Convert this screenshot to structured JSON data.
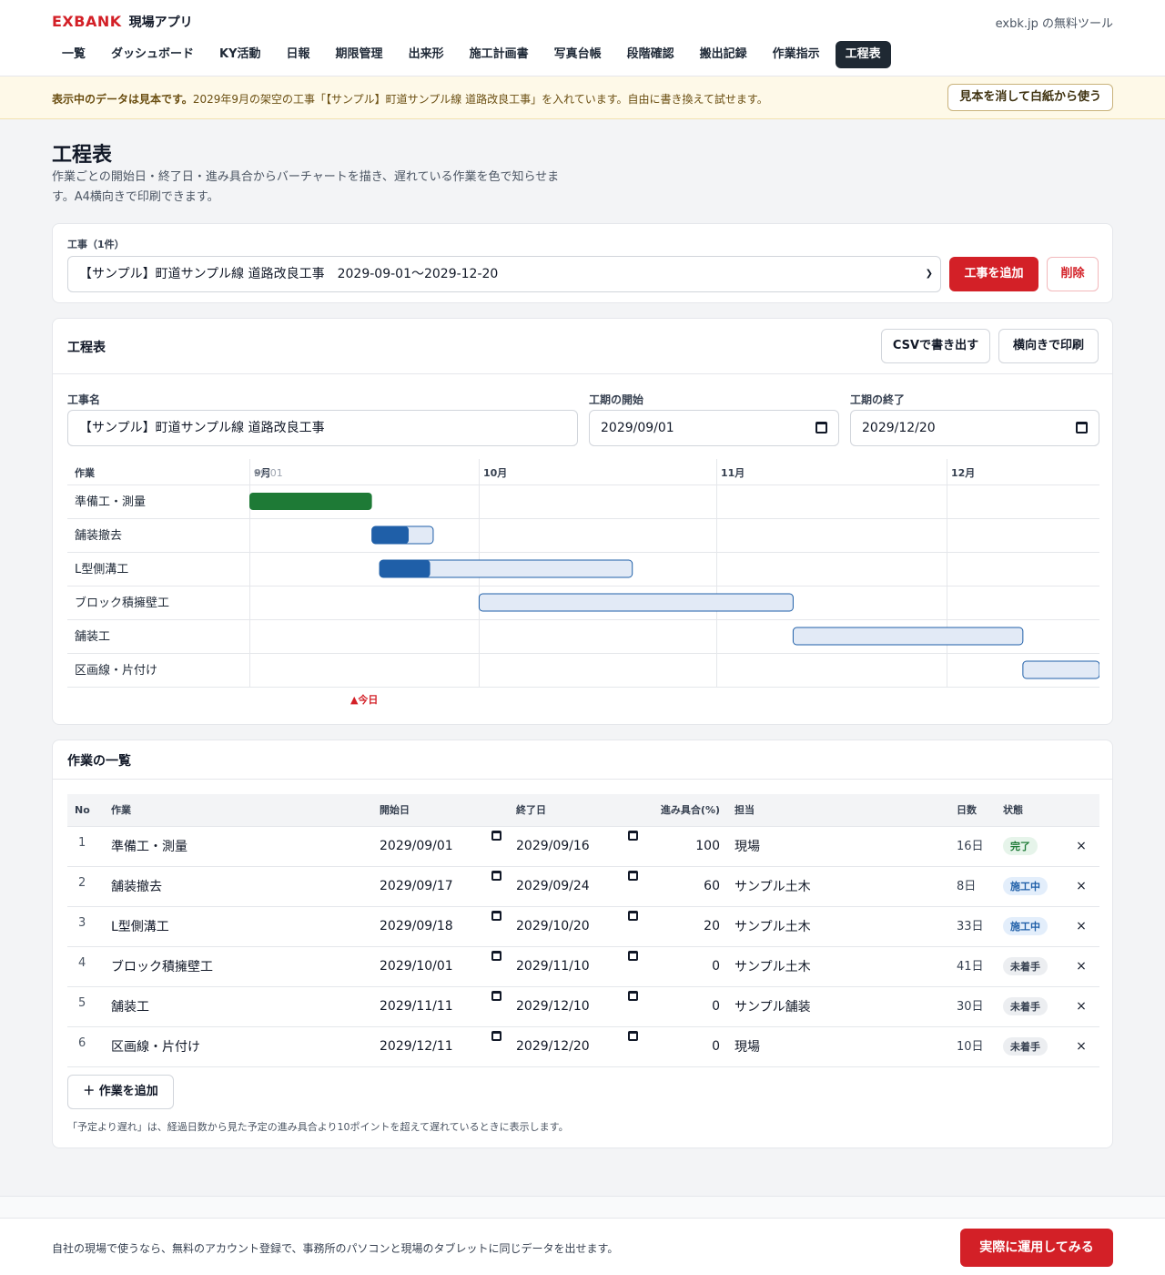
{
  "header": {
    "brand": "EXBANK",
    "app_name": "現場アプリ",
    "ext_link": "exbk.jp の無料ツール",
    "nav": [
      "一覧",
      "ダッシュボード",
      "KY活動",
      "日報",
      "期限管理",
      "出来形",
      "施工計画書",
      "写真台帳",
      "段階確認",
      "搬出記録",
      "作業指示",
      "工程表"
    ],
    "active_nav": "工程表"
  },
  "banner": {
    "bold": "表示中のデータは見本です。",
    "text": "2029年9月の架空の工事「【サンプル】町道サンプル線 道路改良工事」を入れています。自由に書き換えて試せます。",
    "button": "見本を消して白紙から使う"
  },
  "page": {
    "title": "工程表",
    "description": "作業ごとの開始日・終了日・進み具合からバーチャートを描き、遅れている作業を色で知らせます。A4横向きで印刷できます。"
  },
  "project_select": {
    "label": "工事（1件）",
    "selected": "【サンプル】町道サンプル線 道路改良工事　2029-09-01〜2029-12-20",
    "add_button": "工事を追加",
    "delete_button": "削除"
  },
  "schedule": {
    "title": "工程表",
    "csv_button": "CSVで書き出す",
    "print_button": "横向きで印刷",
    "name_label": "工事名",
    "name_value": "【サンプル】町道サンプル線 道路改良工事",
    "start_label": "工期の開始",
    "start_value": "2029/09/01",
    "end_label": "工期の終了",
    "end_value": "2029/12/20",
    "task_header": "作業",
    "today_label": "▲今日"
  },
  "chart_data": {
    "type": "gantt",
    "range": [
      "2029-09-01",
      "2029-12-20"
    ],
    "today": "2029-09-16",
    "months": [
      {
        "label": "9月",
        "date": "2029-09-01"
      },
      {
        "label": "10月",
        "date": "2029-10-01"
      },
      {
        "label": "11月",
        "date": "2029-11-01"
      },
      {
        "label": "12月",
        "date": "2029-12-01"
      }
    ],
    "start_tick_label": "09/01",
    "bars": [
      {
        "task": "準備工・測量",
        "start": "2029-09-01",
        "end": "2029-09-16",
        "progress": 100
      },
      {
        "task": "舗装撤去",
        "start": "2029-09-17",
        "end": "2029-09-24",
        "progress": 60
      },
      {
        "task": "L型側溝工",
        "start": "2029-09-18",
        "end": "2029-10-20",
        "progress": 20
      },
      {
        "task": "ブロック積擁壁工",
        "start": "2029-10-01",
        "end": "2029-11-10",
        "progress": 0
      },
      {
        "task": "舗装工",
        "start": "2029-11-11",
        "end": "2029-12-10",
        "progress": 0
      },
      {
        "task": "区画線・片付け",
        "start": "2029-12-11",
        "end": "2029-12-20",
        "progress": 0
      }
    ],
    "colors": {
      "done": "#1e7a36",
      "progress": "#1f5fa8",
      "remaining": "#e2eaf6",
      "today": "#d32027"
    }
  },
  "task_list": {
    "title": "作業の一覧",
    "columns": [
      "No",
      "作業",
      "開始日",
      "終了日",
      "進み具合(%)",
      "担当",
      "日数",
      "状態"
    ],
    "rows": [
      {
        "no": "1",
        "name": "準備工・測量",
        "start": "2029/09/01",
        "end": "2029/09/16",
        "progress": "100",
        "owner": "現場",
        "days": "16日",
        "status": "完了",
        "status_type": "done"
      },
      {
        "no": "2",
        "name": "舗装撤去",
        "start": "2029/09/17",
        "end": "2029/09/24",
        "progress": "60",
        "owner": "サンプル土木",
        "days": "8日",
        "status": "施工中",
        "status_type": "prog"
      },
      {
        "no": "3",
        "name": "L型側溝工",
        "start": "2029/09/18",
        "end": "2029/10/20",
        "progress": "20",
        "owner": "サンプル土木",
        "days": "33日",
        "status": "施工中",
        "status_type": "prog"
      },
      {
        "no": "4",
        "name": "ブロック積擁壁工",
        "start": "2029/10/01",
        "end": "2029/11/10",
        "progress": "0",
        "owner": "サンプル土木",
        "days": "41日",
        "status": "未着手",
        "status_type": "todo"
      },
      {
        "no": "5",
        "name": "舗装工",
        "start": "2029/11/11",
        "end": "2029/12/10",
        "progress": "0",
        "owner": "サンプル舗装",
        "days": "30日",
        "status": "未着手",
        "status_type": "todo"
      },
      {
        "no": "6",
        "name": "区画線・片付け",
        "start": "2029/12/11",
        "end": "2029/12/20",
        "progress": "0",
        "owner": "現場",
        "days": "10日",
        "status": "未着手",
        "status_type": "todo"
      }
    ],
    "delete_icon": "×",
    "add_button": "＋ 作業を追加",
    "note": "「予定より遅れ」は、経過日数から見た予定の進み具合より10ポイントを超えて遅れているときに表示します。"
  },
  "footer": {
    "text": "自社の現場で使うなら、無料のアカウント登録で、事務所のパソコンと現場のタブレットに同じデータを出せます。",
    "button": "実際に運用してみる"
  }
}
